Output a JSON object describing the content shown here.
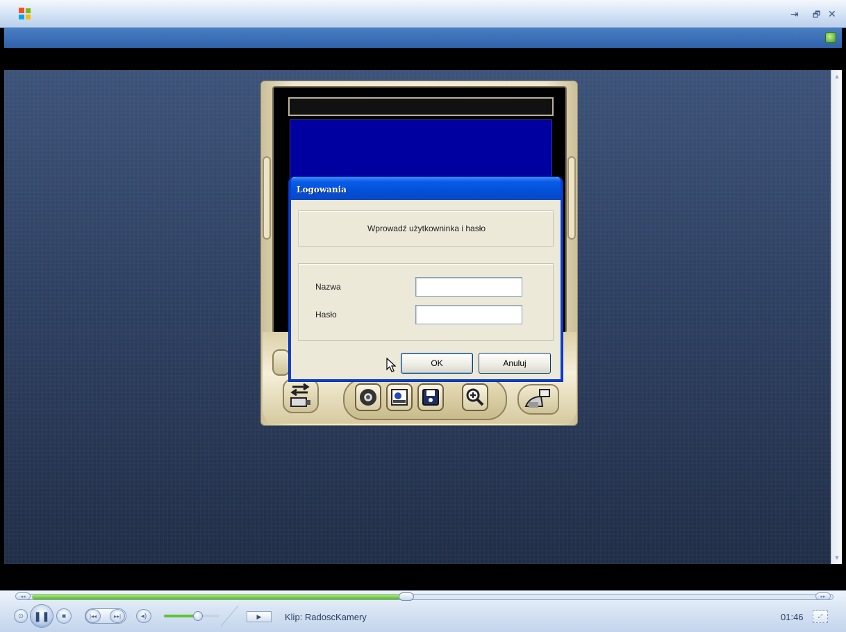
{
  "window": {
    "pin_glyph": "⇥",
    "restore_glyph": "🗗",
    "close_glyph": "✕"
  },
  "dialog": {
    "title": "Logowania",
    "prompt": "Wprowadź użytkowninka i hasło",
    "name_label": "Nazwa",
    "password_label": "Hasło",
    "name_value": "",
    "password_value": "",
    "ok_label": "OK",
    "cancel_label": "Anuluj"
  },
  "player": {
    "clip_label": "Klip: RadoscKamery",
    "time": "01:46",
    "seek_progress": 0.47,
    "volume_level": 0.6,
    "buttons": [
      "shuffle",
      "pause",
      "stop",
      "previous",
      "next",
      "mute",
      "now-playing"
    ]
  },
  "colors": {
    "dialog_title": "#0a5ce8",
    "seek_fill": "#53b625",
    "camera_screen": "#0000a0"
  }
}
